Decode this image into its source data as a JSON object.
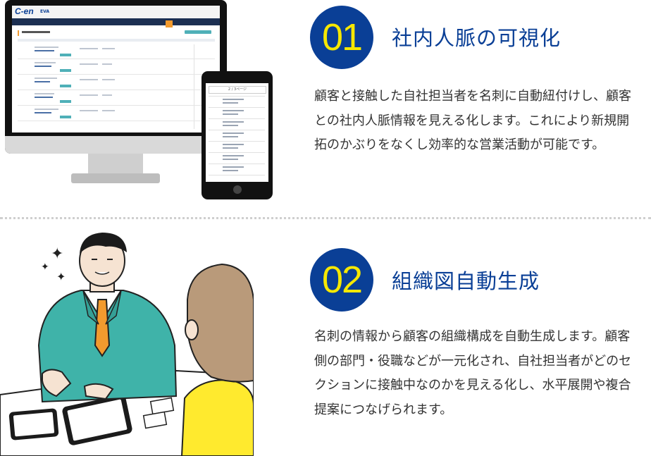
{
  "features": [
    {
      "number": "01",
      "title": "社内人脈の可視化",
      "body": "顧客と接触した自社担当者を名刺に自動紐付けし、顧客との社内人脈情報を見える化します。これにより新規開拓のかぶりをなくし効率的な営業活動が可能です。"
    },
    {
      "number": "02",
      "title": "組織図自動生成",
      "body": "名刺の情報から顧客の組織構成を自動生成します。顧客側の部門・役職などが一元化され、自社担当者がどのセクションに接触中なのかを見える化し、水平展開や複合提案につなげられます。"
    }
  ],
  "illustration_1": {
    "monitor_logo": "C-en",
    "tablet_pager": "2 / 3ページ",
    "colors": {
      "navy": "#0a3f96",
      "badge_text": "#f6e800",
      "teal": "#4fb0b8",
      "orange": "#f29a2e"
    }
  },
  "illustration_2": {
    "colors": {
      "suit": "#3fb3a9",
      "tie": "#f29a2e",
      "woman_hair": "#b99a7a",
      "woman_top": "#ffea2e"
    }
  }
}
